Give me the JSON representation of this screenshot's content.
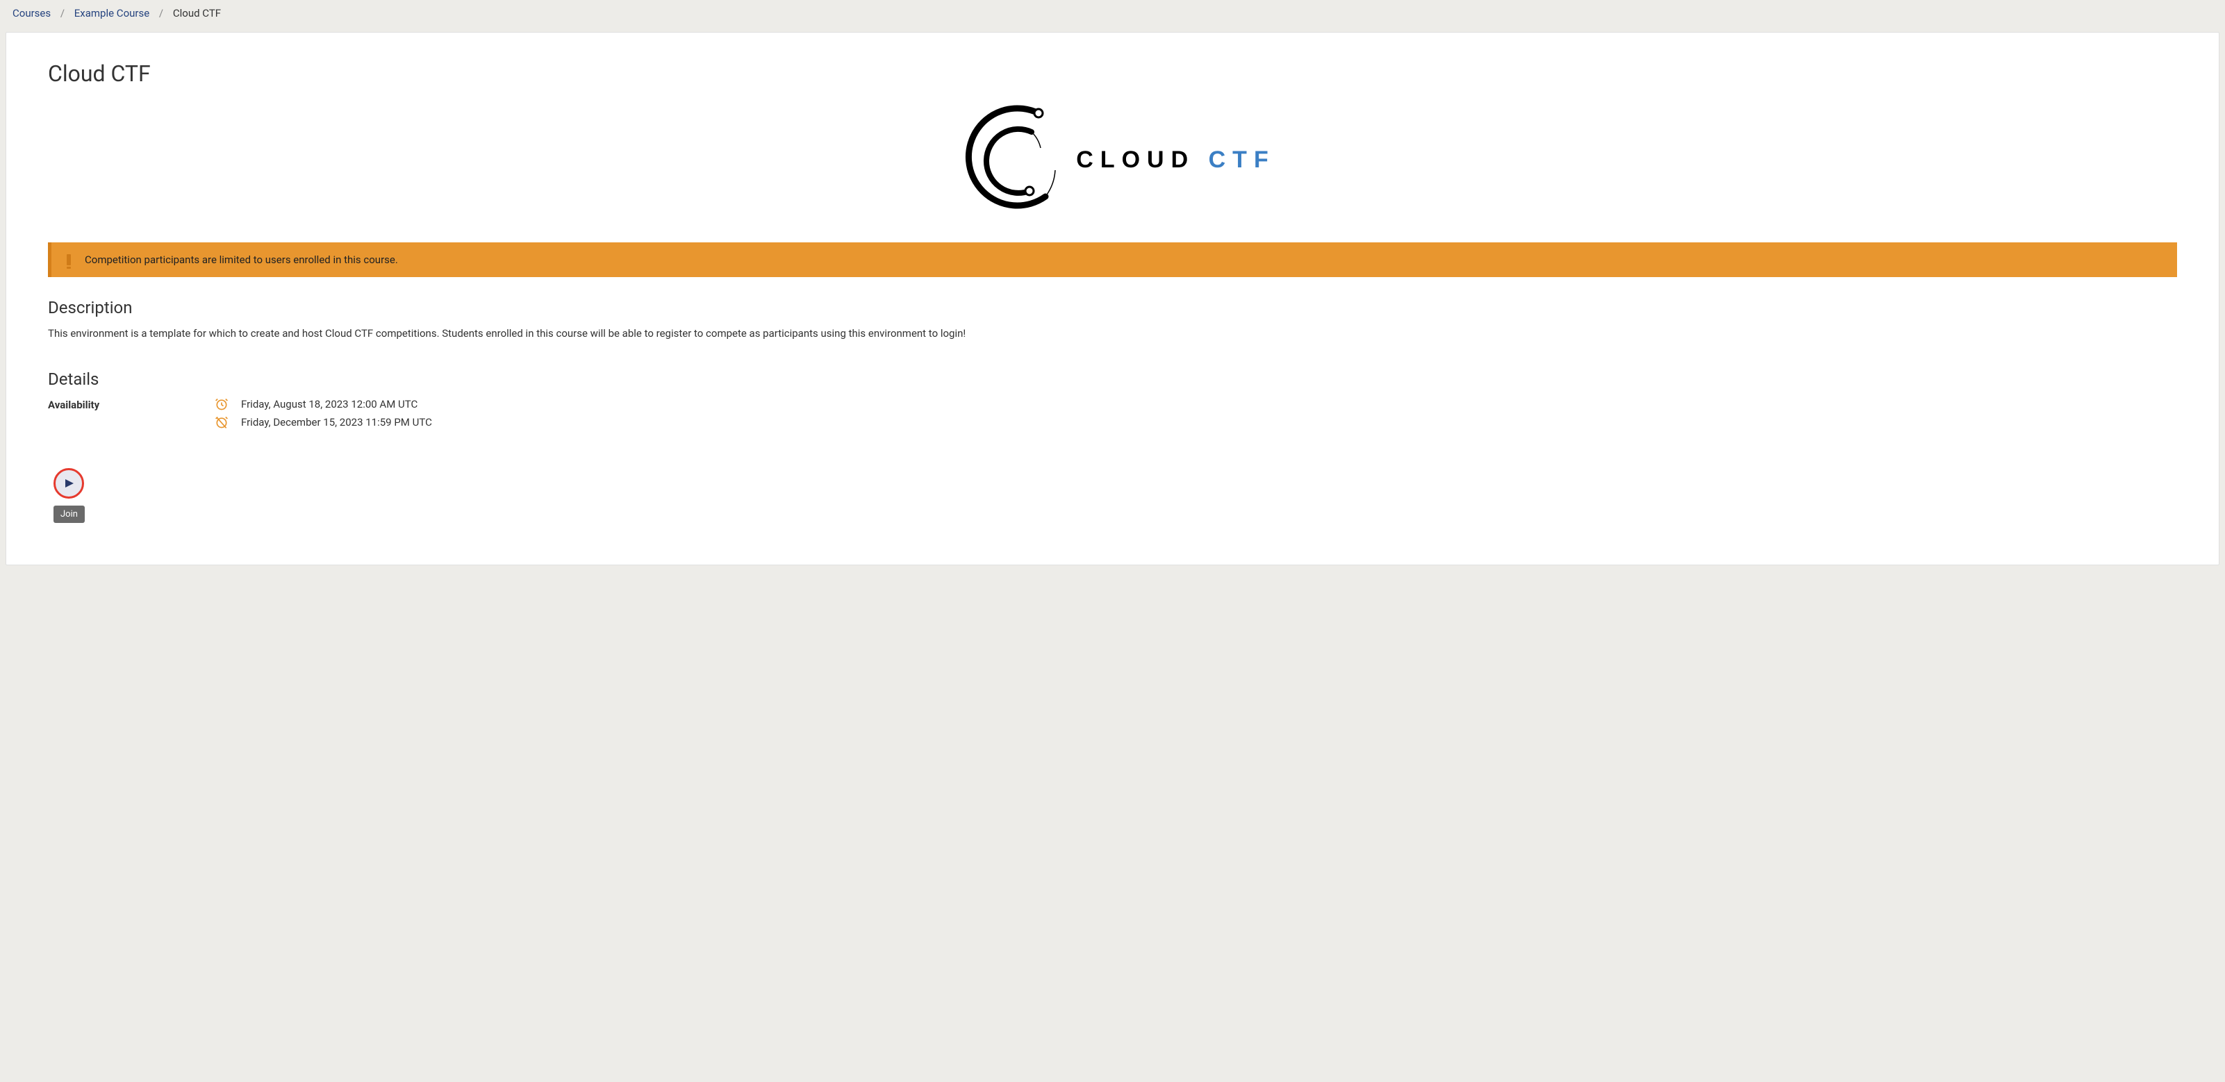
{
  "breadcrumb": {
    "courses": "Courses",
    "example_course": "Example Course",
    "current": "Cloud CTF"
  },
  "page": {
    "title": "Cloud CTF"
  },
  "logo": {
    "text_black": "CLOUD",
    "text_blue": "CTF"
  },
  "alert": {
    "message": "Competition participants are limited to users enrolled in this course."
  },
  "description": {
    "heading": "Description",
    "text": "This environment is a template for which to create and host Cloud CTF competitions. Students enrolled in this course will be able to register to compete as participants using this environment to login!"
  },
  "details": {
    "heading": "Details",
    "availability_label": "Availability",
    "start": "Friday, August 18, 2023 12:00 AM UTC",
    "end": "Friday, December 15, 2023 11:59 PM UTC"
  },
  "join": {
    "tooltip": "Join"
  }
}
